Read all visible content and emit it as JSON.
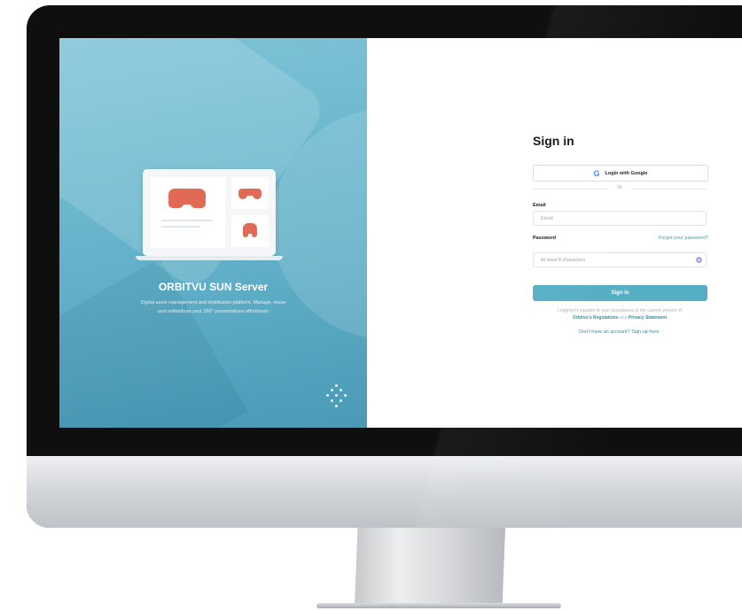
{
  "promo": {
    "title": "ORBITVU SUN Server",
    "description": "Digital asset management and distribution platform. Manage, reuse and redistribute your 360° presentations effortlessly"
  },
  "signin": {
    "title": "Sign in",
    "google_button": "Login with Google",
    "google_icon": "G",
    "divider": "Or",
    "email_label": "Email",
    "email_placeholder": "Email",
    "password_label": "Password",
    "password_placeholder": "At least 8 characters",
    "forgot_link": "Forgot your password?",
    "submit_label": "Sign in",
    "terms_prefix": "Logging in equates to your acceptance of the current version of",
    "terms_link_regulations": "Orbitvu's Regulations",
    "terms_and": "and",
    "terms_link_privacy": "Privacy Statement",
    "signup_link": "Don't have an account? Sign up here."
  },
  "icons": {
    "google": "google-icon",
    "eye": "eye-icon",
    "gamepad": "gamepad-icon",
    "dots": "dots-logo-icon"
  },
  "colors": {
    "accent": "#55aec3",
    "link": "#2d8fa6",
    "promo_bg": "#62b1c9",
    "gamepad": "#e06a56"
  }
}
